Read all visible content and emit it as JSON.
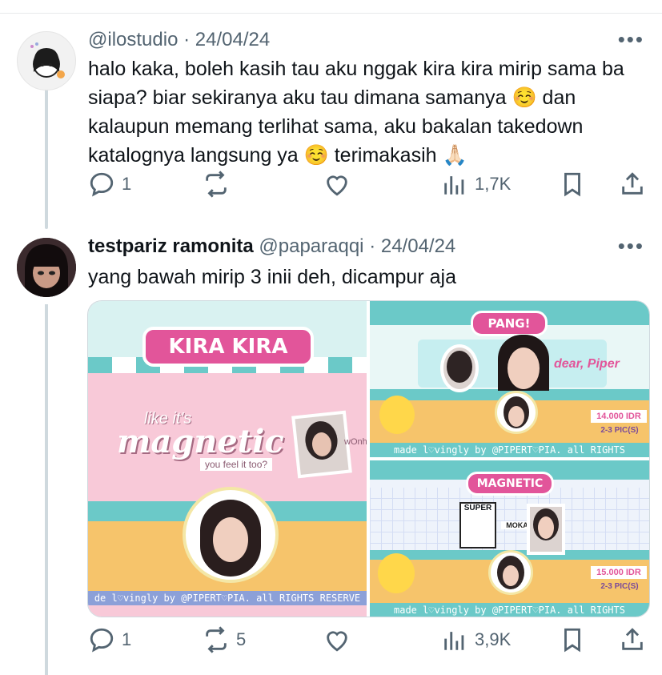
{
  "tweet1": {
    "handle": "@ilostudio",
    "sep": "·",
    "date": "24/04/24",
    "text": "halo kaka, boleh kasih tau aku nggak kira kira mirip sama ba siapa? biar sekiranya aku tau dimana samanya ☺️ dan kalaupun memang terlihat sama, aku bakalan takedown katalognya langsung ya ☺️ terimakasih 🙏🏻",
    "replies": "1",
    "retweets": "",
    "views": "1,7K"
  },
  "tweet2": {
    "name": "testpariz ramonita",
    "handle": "@paparaqqi",
    "sep": "·",
    "date": "24/04/24",
    "text": "yang bawah mirip 3 inii deh, dicampur aja",
    "replies": "1",
    "retweets": "5",
    "views": "3,9K",
    "media": {
      "left": {
        "banner": "KIRA KIRA",
        "line1": "like it's",
        "line2": "magnetic",
        "line3": "you feel it too?",
        "tag": "wOnhEe",
        "footer": "de l♡vingly by @PIPERT♡PIA. all RIGHTS RESERVE"
      },
      "top_right": {
        "banner": "PANG!",
        "script": "dear, Piper",
        "price": "14.000 IDR",
        "pics": "2-3 PIC(S)",
        "footer": "made l♡vingly by @PIPERT♡PIA. all RIGHTS RESERVED"
      },
      "bottom_right": {
        "banner": "MAGNETIC",
        "card": "SUPER",
        "name": "MOKA",
        "price": "15.000 IDR",
        "pics": "2-3 PIC(S)",
        "footer": "made l♡vingly by @PIPERT♡PIA. all RIGHTS RESERVED"
      }
    }
  },
  "colors": {
    "muted": "#536471",
    "text": "#0f1419",
    "pink": "#e2559a",
    "teal": "#6bc9c8",
    "sand": "#f6c46b"
  },
  "icons": [
    "reply-icon",
    "retweet-icon",
    "like-icon",
    "views-icon",
    "bookmark-icon",
    "share-icon",
    "more-icon"
  ]
}
